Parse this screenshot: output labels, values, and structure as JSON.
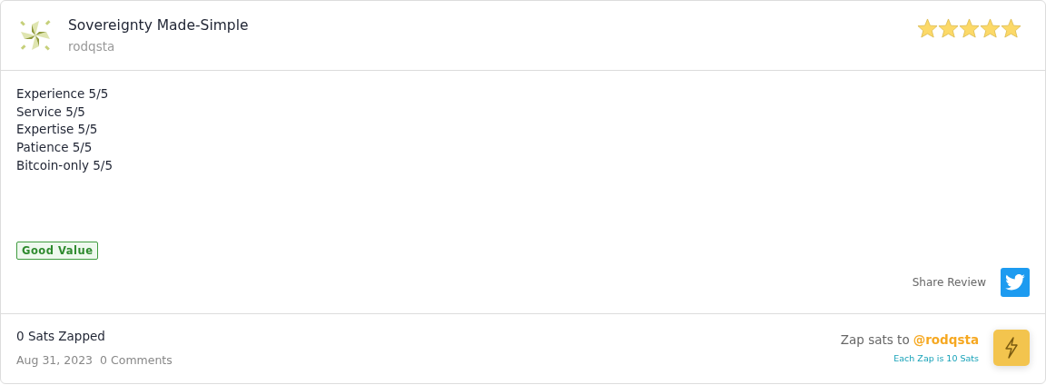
{
  "review": {
    "title": "Sovereignty Made-Simple",
    "author": "rodqsta",
    "stars": 5,
    "lines": [
      "Experience 5/5",
      "Service 5/5",
      "Expertise 5/5",
      "Patience 5/5",
      "Bitcoin-only 5/5"
    ],
    "tag": "Good Value",
    "share_label": "Share Review"
  },
  "footer": {
    "zapped": "0 Sats Zapped",
    "date": "Aug 31, 2023",
    "comments_count": "0",
    "comments_label": "Comments",
    "zap_prefix": "Zap sats to",
    "zap_handle": "@rodqsta",
    "zap_note": "Each Zap is 10 Sats"
  }
}
